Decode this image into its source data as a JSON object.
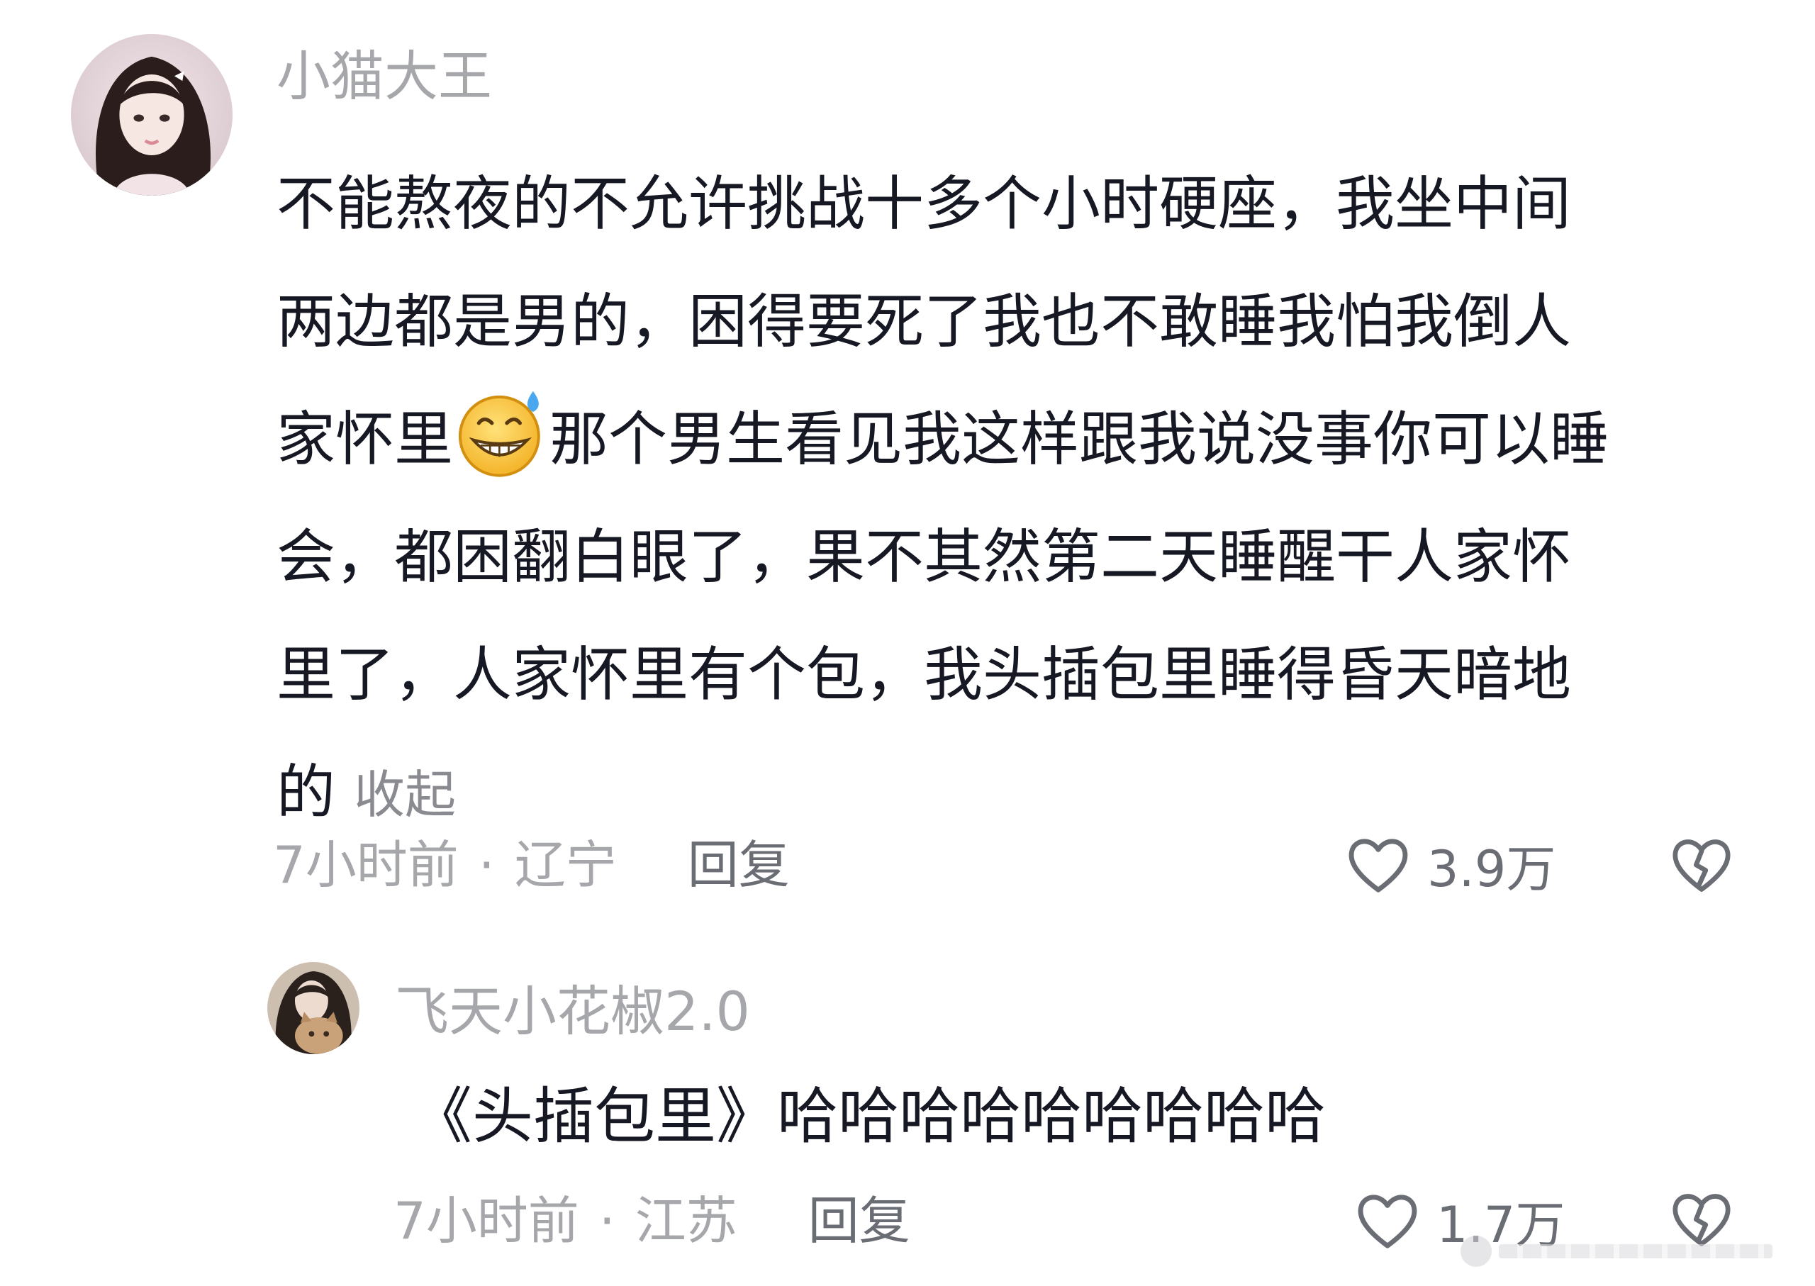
{
  "comment": {
    "username": "小猫大王",
    "body_lines": [
      "不能熬夜的不允许挑战十多个小时硬座，我坐中间",
      "两边都是男的，困得要死了我也不敢睡我怕我倒人",
      "那个男生看见我这样跟我说没事你可以睡",
      "会，都困翻白眼了，果不其然第二天睡醒干人家怀",
      "里了，人家怀里有个包，我头插包里睡得昏天暗地",
      "的"
    ],
    "line3_prefix": "家怀里",
    "emoji_icon": "sweat-grin-emoji",
    "collapse_label": "收起",
    "time": "7小时前",
    "separator": "·",
    "location": "辽宁",
    "reply_label": "回复",
    "like_count": "3.9万"
  },
  "reply": {
    "username": "飞天小花椒2.0",
    "body": "《头插包里》哈哈哈哈哈哈哈哈哈",
    "time": "7小时前",
    "separator": "·",
    "location": "江苏",
    "reply_label": "回复",
    "like_count": "1.7万"
  },
  "icons": {
    "like": "heart-outline-icon",
    "dislike": "broken-heart-icon"
  }
}
